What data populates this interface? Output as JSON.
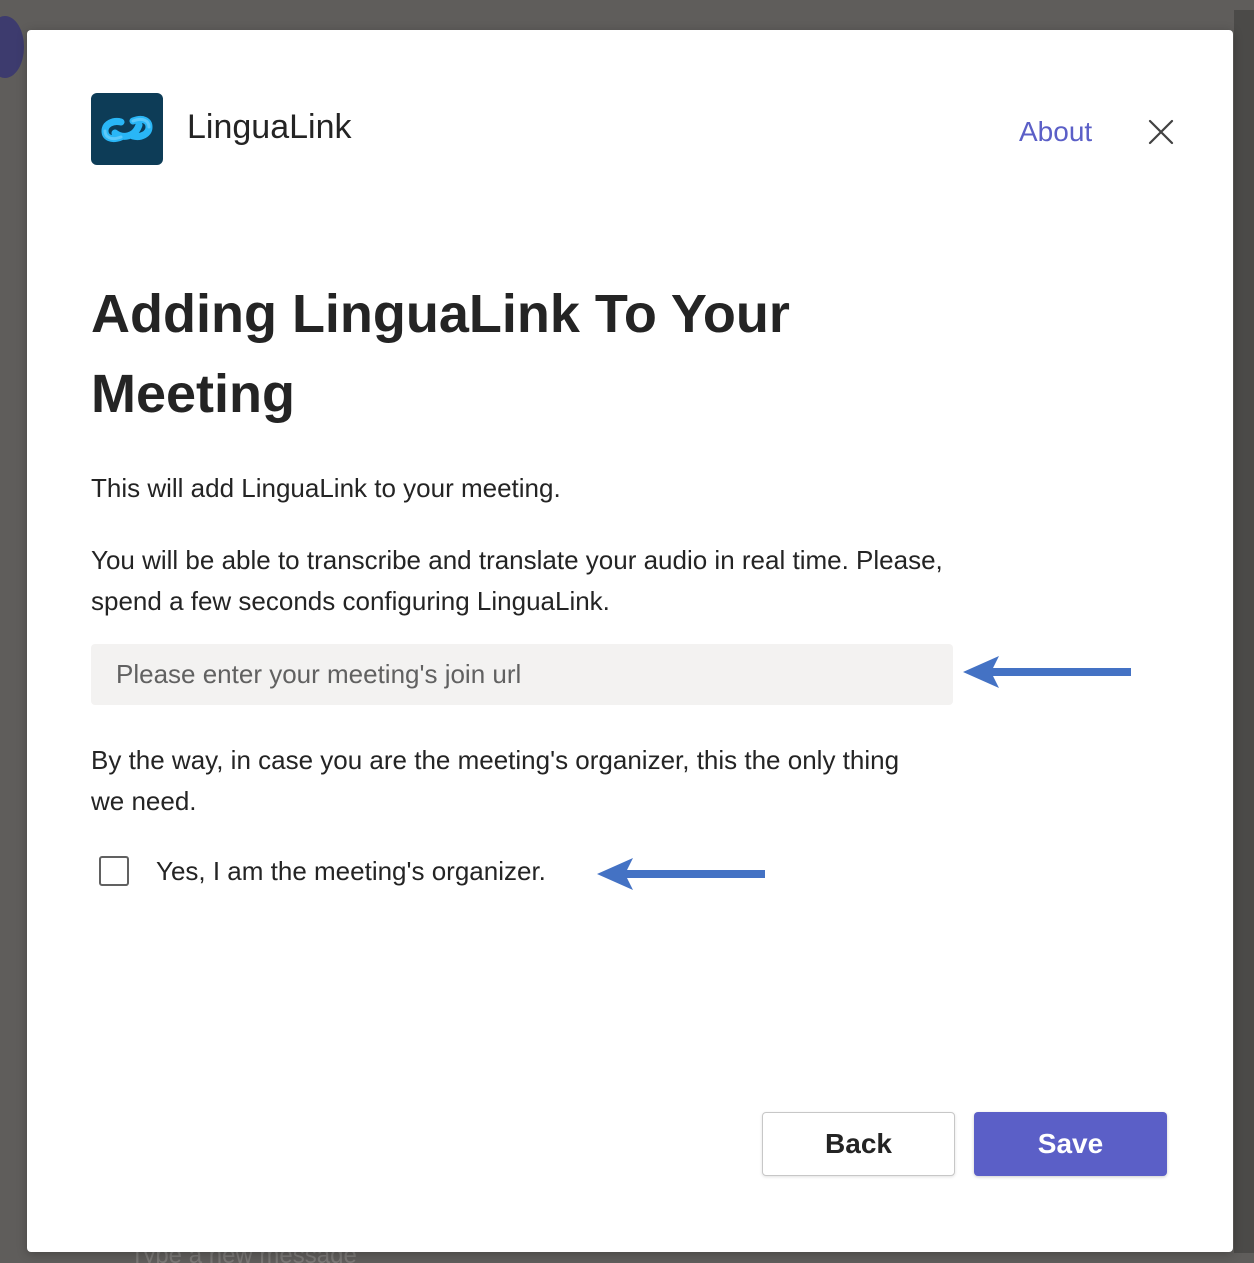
{
  "background": {
    "compose_placeholder": "Type a new message"
  },
  "dialog": {
    "app_name": "LinguaLink",
    "about_label": "About",
    "close_icon": "close-icon",
    "title": "Adding LinguaLink To Your Meeting",
    "intro": "This will add LinguaLink to your meeting.",
    "description": "You will be able to transcribe and translate your audio in real time. Please, spend a few seconds configuring LinguaLink.",
    "url_input": {
      "placeholder": "Please enter your meeting's join url",
      "value": ""
    },
    "organizer_note": "By the way, in case you are the meeting's organizer, this the only thing we need.",
    "organizer_checkbox": {
      "label": "Yes, I am the meeting's organizer.",
      "checked": false
    },
    "back_label": "Back",
    "save_label": "Save"
  },
  "annotations": {
    "arrow_color": "#4472c4",
    "arrow_icon": "left-arrow-icon"
  },
  "colors": {
    "accent": "#5b5fc7",
    "logo_bg": "#0d3c57",
    "logo_link": "#29b6f6",
    "input_bg": "#f3f2f1"
  }
}
